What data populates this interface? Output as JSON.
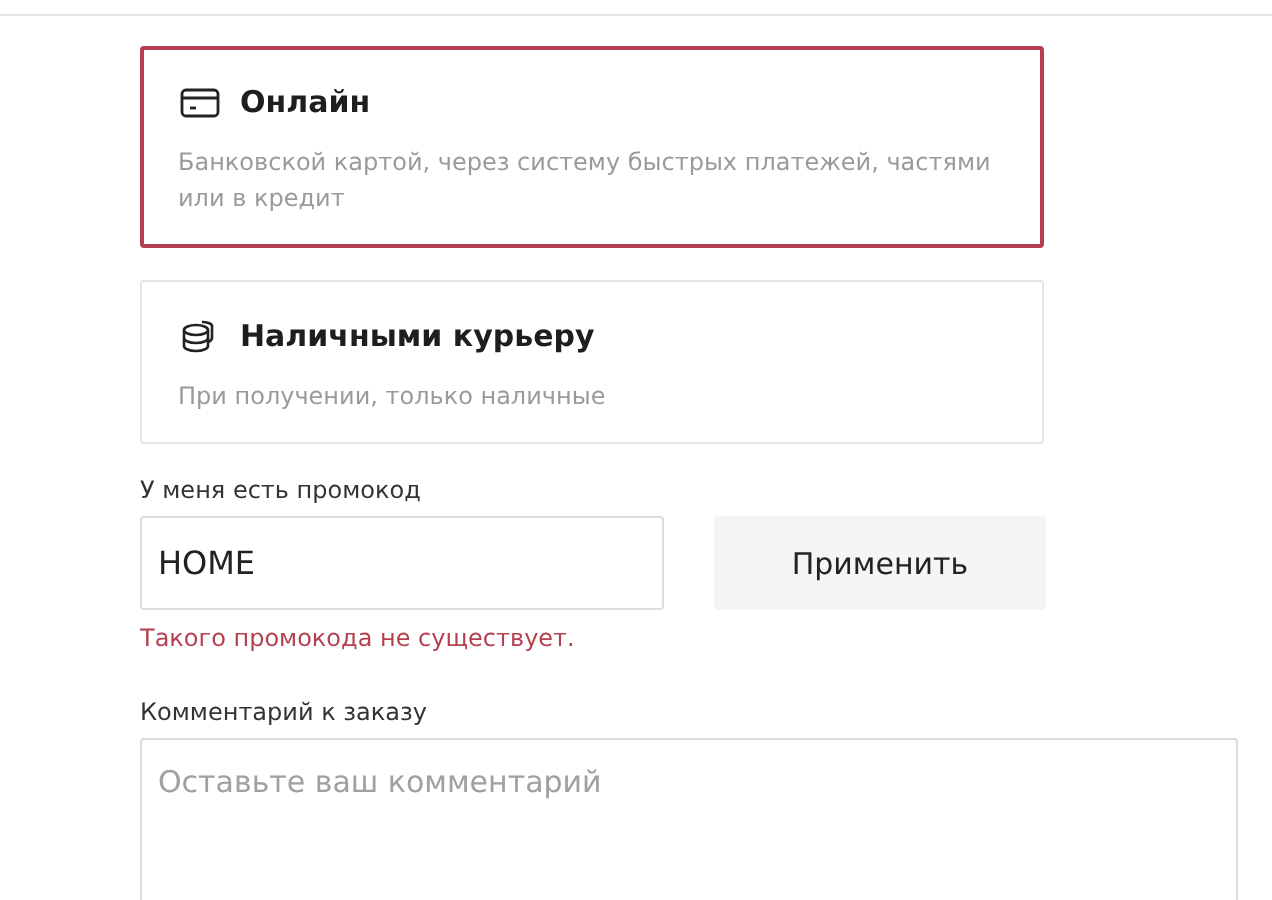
{
  "payment_options": [
    {
      "kind": "card",
      "title": "Онлайн",
      "description": "Банковской картой, через систему быстрых платежей, частями или в кредит",
      "selected": true
    },
    {
      "kind": "cash",
      "title": "Наличными курьеру",
      "description": "При получении, только наличные",
      "selected": false
    }
  ],
  "promo": {
    "label": "У меня есть промокод",
    "value": "HOME",
    "button": "Применить",
    "error": "Такого промокода не существует."
  },
  "comment": {
    "label": "Комментарий к заказу",
    "placeholder": "Оставьте ваш комментарий"
  }
}
